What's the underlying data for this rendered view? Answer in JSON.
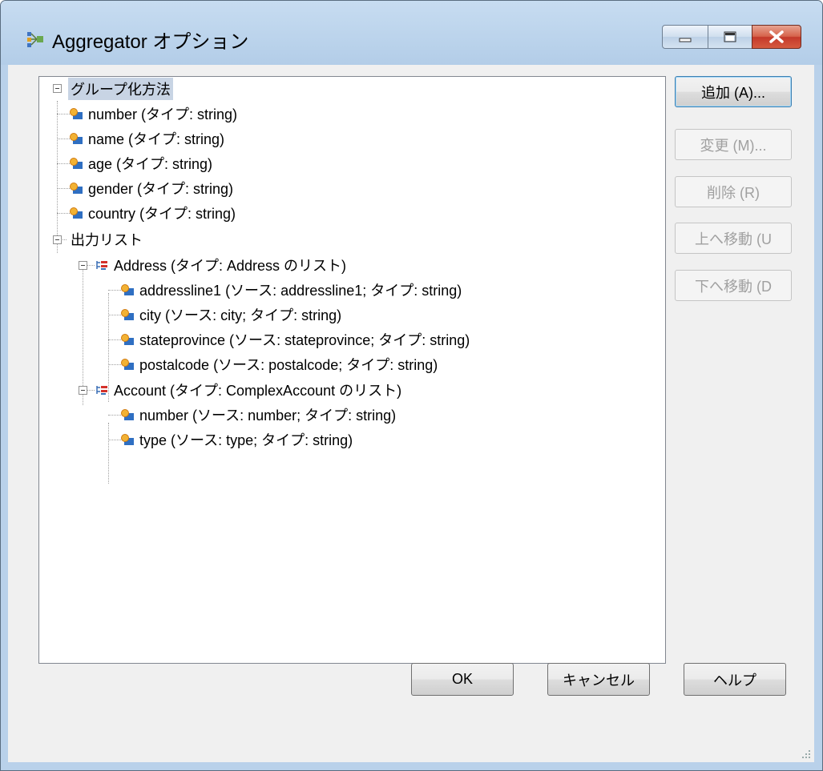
{
  "window": {
    "title": "Aggregator オプション",
    "icon": "aggregator-app-icon"
  },
  "caption_buttons": [
    {
      "name": "minimize",
      "icon": "minimize-icon"
    },
    {
      "name": "maximize",
      "icon": "maximize-icon"
    },
    {
      "name": "close",
      "icon": "close-x-icon"
    }
  ],
  "tree": {
    "nodes": [
      {
        "label": "グループ化方法",
        "selected": true,
        "expander": "minus"
      },
      {
        "label": "number (タイプ: string)",
        "icon": "field-icon"
      },
      {
        "label": "name (タイプ: string)",
        "icon": "field-icon"
      },
      {
        "label": "age (タイプ: string)",
        "icon": "field-icon"
      },
      {
        "label": "gender (タイプ: string)",
        "icon": "field-icon"
      },
      {
        "label": "country (タイプ: string)",
        "icon": "field-icon"
      },
      {
        "label": "出力リスト",
        "expander": "minus"
      },
      {
        "label": "Address (タイプ: Address のリスト)",
        "icon": "list-icon",
        "expander": "minus"
      },
      {
        "label": "addressline1 (ソース: addressline1; タイプ: string)",
        "icon": "field-icon"
      },
      {
        "label": "city (ソース: city; タイプ: string)",
        "icon": "field-icon"
      },
      {
        "label": "stateprovince (ソース: stateprovince; タイプ: string)",
        "icon": "field-icon"
      },
      {
        "label": "postalcode (ソース: postalcode; タイプ: string)",
        "icon": "field-icon"
      },
      {
        "label": "Account (タイプ: ComplexAccount のリスト)",
        "icon": "list-icon",
        "expander": "minus"
      },
      {
        "label": "number (ソース: number; タイプ: string)",
        "icon": "field-icon"
      },
      {
        "label": "type (ソース: type; タイプ: string)",
        "icon": "field-icon"
      }
    ]
  },
  "side_buttons": {
    "add": "追加 (A)...",
    "edit": "変更 (M)...",
    "delete": "削除 (R)",
    "move_up": "上へ移動 (U",
    "move_down": "下へ移動 (D"
  },
  "bottom_buttons": {
    "ok": "OK",
    "cancel": "キャンセル",
    "help": "ヘルプ"
  }
}
